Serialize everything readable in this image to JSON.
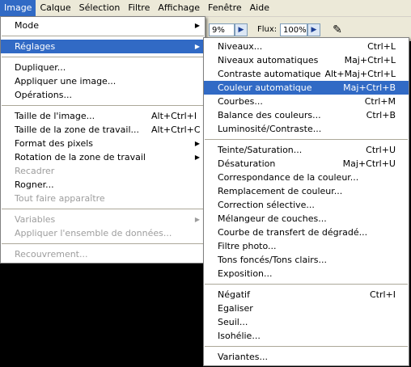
{
  "menubar": {
    "items": [
      {
        "label": "Image",
        "active": true
      },
      {
        "label": "Calque"
      },
      {
        "label": "Sélection"
      },
      {
        "label": "Filtre"
      },
      {
        "label": "Affichage"
      },
      {
        "label": "Fenêtre"
      },
      {
        "label": "Aide"
      }
    ]
  },
  "options": {
    "opacity_value": "9%",
    "flux_label": "Flux:",
    "flux_value": "100%",
    "arrow_icon": "triangle-right-icon",
    "brush_icon": "airbrush-icon"
  },
  "image_menu": {
    "mode": "Mode",
    "reglages": "Réglages",
    "dupliquer": "Dupliquer...",
    "appliquer_image": "Appliquer une image...",
    "operations": "Opérations...",
    "taille_image": "Taille de l'image...",
    "taille_image_sc": "Alt+Ctrl+I",
    "taille_zone": "Taille de la zone de travail...",
    "taille_zone_sc": "Alt+Ctrl+C",
    "format_pixels": "Format des pixels",
    "rotation": "Rotation de la zone de travail",
    "recadrer": "Recadrer",
    "rogner": "Rogner...",
    "tout_faire": "Tout faire apparaître",
    "variables": "Variables",
    "appliquer_ensemble": "Appliquer l'ensemble de données...",
    "recouvrement": "Recouvrement..."
  },
  "reglages_menu": {
    "niveaux": "Niveaux...",
    "niveaux_sc": "Ctrl+L",
    "niveaux_auto": "Niveaux automatiques",
    "niveaux_auto_sc": "Maj+Ctrl+L",
    "contraste_auto": "Contraste automatique",
    "contraste_auto_sc": "Alt+Maj+Ctrl+L",
    "couleur_auto": "Couleur automatique",
    "couleur_auto_sc": "Maj+Ctrl+B",
    "courbes": "Courbes...",
    "courbes_sc": "Ctrl+M",
    "balance": "Balance des couleurs...",
    "balance_sc": "Ctrl+B",
    "luminosite": "Luminosité/Contraste...",
    "teinte": "Teinte/Saturation...",
    "teinte_sc": "Ctrl+U",
    "desaturation": "Désaturation",
    "desaturation_sc": "Maj+Ctrl+U",
    "correspondance": "Correspondance de la couleur...",
    "remplacement": "Remplacement de couleur...",
    "correction": "Correction sélective...",
    "melangeur": "Mélangeur de couches...",
    "courbe_degrade": "Courbe de transfert de dégradé...",
    "filtre_photo": "Filtre photo...",
    "tons": "Tons foncés/Tons clairs...",
    "exposition": "Exposition...",
    "negatif": "Négatif",
    "negatif_sc": "Ctrl+I",
    "egaliser": "Egaliser",
    "seuil": "Seuil...",
    "isohelie": "Isohélie...",
    "variantes": "Variantes..."
  },
  "colors": {
    "highlight": "#316ac5",
    "menubar_bg": "#ece9d8",
    "disabled_text": "#9d9d9d"
  }
}
